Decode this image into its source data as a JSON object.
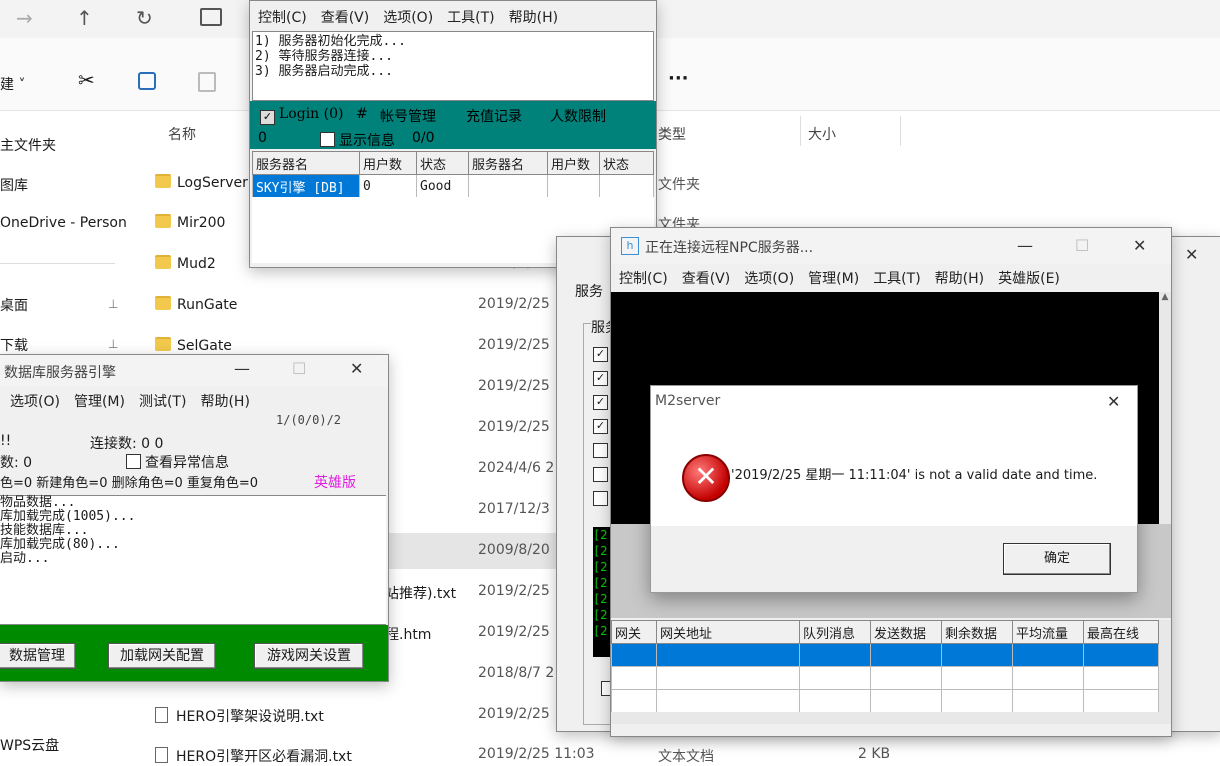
{
  "explorer": {
    "nav": {
      "back": "→",
      "up": "↑",
      "refresh": "↻"
    },
    "new_label": "建",
    "more": "···",
    "col_name": "名称",
    "col_type": "类型",
    "col_size": "大小",
    "sidebar": [
      {
        "label": "主文件夹"
      },
      {
        "label": "图库"
      },
      {
        "label": "OneDrive - Person"
      },
      {
        "label": "桌面",
        "pin": "📌"
      },
      {
        "label": "下载",
        "pin": "📌"
      },
      {
        "label": "WPS云盘"
      }
    ],
    "files": [
      {
        "name": "LogServer",
        "kind": "folder",
        "date": "",
        "type": "文件夹"
      },
      {
        "name": "Mir200",
        "kind": "folder",
        "date": "",
        "type": "文件夹"
      },
      {
        "name": "Mud2",
        "kind": "folder",
        "date": "2019/2/25",
        "type": ""
      },
      {
        "name": "RunGate",
        "kind": "folder",
        "date": "2019/2/25",
        "type": ""
      },
      {
        "name": "SelGate",
        "kind": "folder",
        "date": "2019/2/25",
        "type": ""
      },
      {
        "name": "",
        "kind": "none",
        "date": "2019/2/25",
        "type": ""
      },
      {
        "name": "",
        "kind": "none",
        "date": "2019/2/25",
        "type": ""
      },
      {
        "name": "",
        "kind": "none",
        "date": "2024/4/6 2",
        "type": ""
      },
      {
        "name": "",
        "kind": "none",
        "date": "2017/12/3",
        "type": ""
      },
      {
        "name": "",
        "kind": "none",
        "date": "2009/8/20",
        "type": ""
      },
      {
        "name": "站推荐).txt",
        "kind": "none",
        "date": "2019/2/25",
        "type": ""
      },
      {
        "name": "程.htm",
        "kind": "none",
        "date": "2019/2/25",
        "type": ""
      },
      {
        "name": "",
        "kind": "none",
        "date": "2018/8/7 2",
        "type": ""
      },
      {
        "name": "HERO引擎架设说明.txt",
        "kind": "doc",
        "date": "2019/2/25",
        "type": ""
      },
      {
        "name": "HERO引擎开区必看漏洞.txt",
        "kind": "doc",
        "date": "2019/2/25 11:03",
        "type": "文本文档",
        "size": "2 KB"
      }
    ]
  },
  "login_win": {
    "menu": [
      "控制(C)",
      "查看(V)",
      "选项(O)",
      "工具(T)",
      "帮助(H)"
    ],
    "log": [
      "1) 服务器初始化完成...",
      "2) 等待服务器连接...",
      "3) 服务器启动完成..."
    ],
    "tabs": {
      "login": "Login (0)",
      "hash": "#",
      "account": "帐号管理",
      "recharge": "充值记录",
      "limit": "人数限制"
    },
    "row2": {
      "zero": "0",
      "show_info": "显示信息",
      "ratio": "0/0"
    },
    "table_headers": [
      "服务器名",
      "用户数",
      "状态",
      "服务器名",
      "用户数",
      "状态"
    ],
    "table_row": [
      "SKY引擎 [DB]",
      "0",
      "Good",
      "",
      "",
      ""
    ]
  },
  "db_win": {
    "title": "数据库服务器引擎",
    "menu": [
      "选项(O)",
      "管理(M)",
      "测试(T)",
      "帮助(H)"
    ],
    "counter": "1/(0/0)/2",
    "line1_left": "!!",
    "conn_label": "连接数: 0   0",
    "line2_left": "数:   0",
    "check_abnormal": "查看异常信息",
    "stats": "色=0  新建角色=0  删除角色=0  重复角色=0",
    "hero": "英雄版",
    "log": [
      "物品数据...",
      "库加载完成(1005)...",
      "技能数据库...",
      "库加载完成(80)...",
      "启动..."
    ],
    "btn_data": "数据管理",
    "btn_gate": "加载网关配置",
    "btn_game": "游戏网关设置"
  },
  "npc_win": {
    "title": "正在连接远程NPC服务器...",
    "menu": [
      "控制(C)",
      "查看(V)",
      "选项(O)",
      "管理(M)",
      "工具(T)",
      "帮助(H)",
      "英雄版(E)"
    ],
    "tab": "服务",
    "group": "服务",
    "log_prefix": [
      "[2",
      "[2",
      "[2",
      "[2",
      "[2",
      "[2",
      "[2"
    ],
    "headers": [
      "网关",
      "网关地址",
      "队列消息",
      "发送数据",
      "剩余数据",
      "平均流量",
      "最高在线"
    ]
  },
  "dialog": {
    "title": "M2server",
    "message": "'2019/2/25 星期一 11:11:04' is not a valid date and time.",
    "ok": "确定",
    "close": "✕"
  }
}
